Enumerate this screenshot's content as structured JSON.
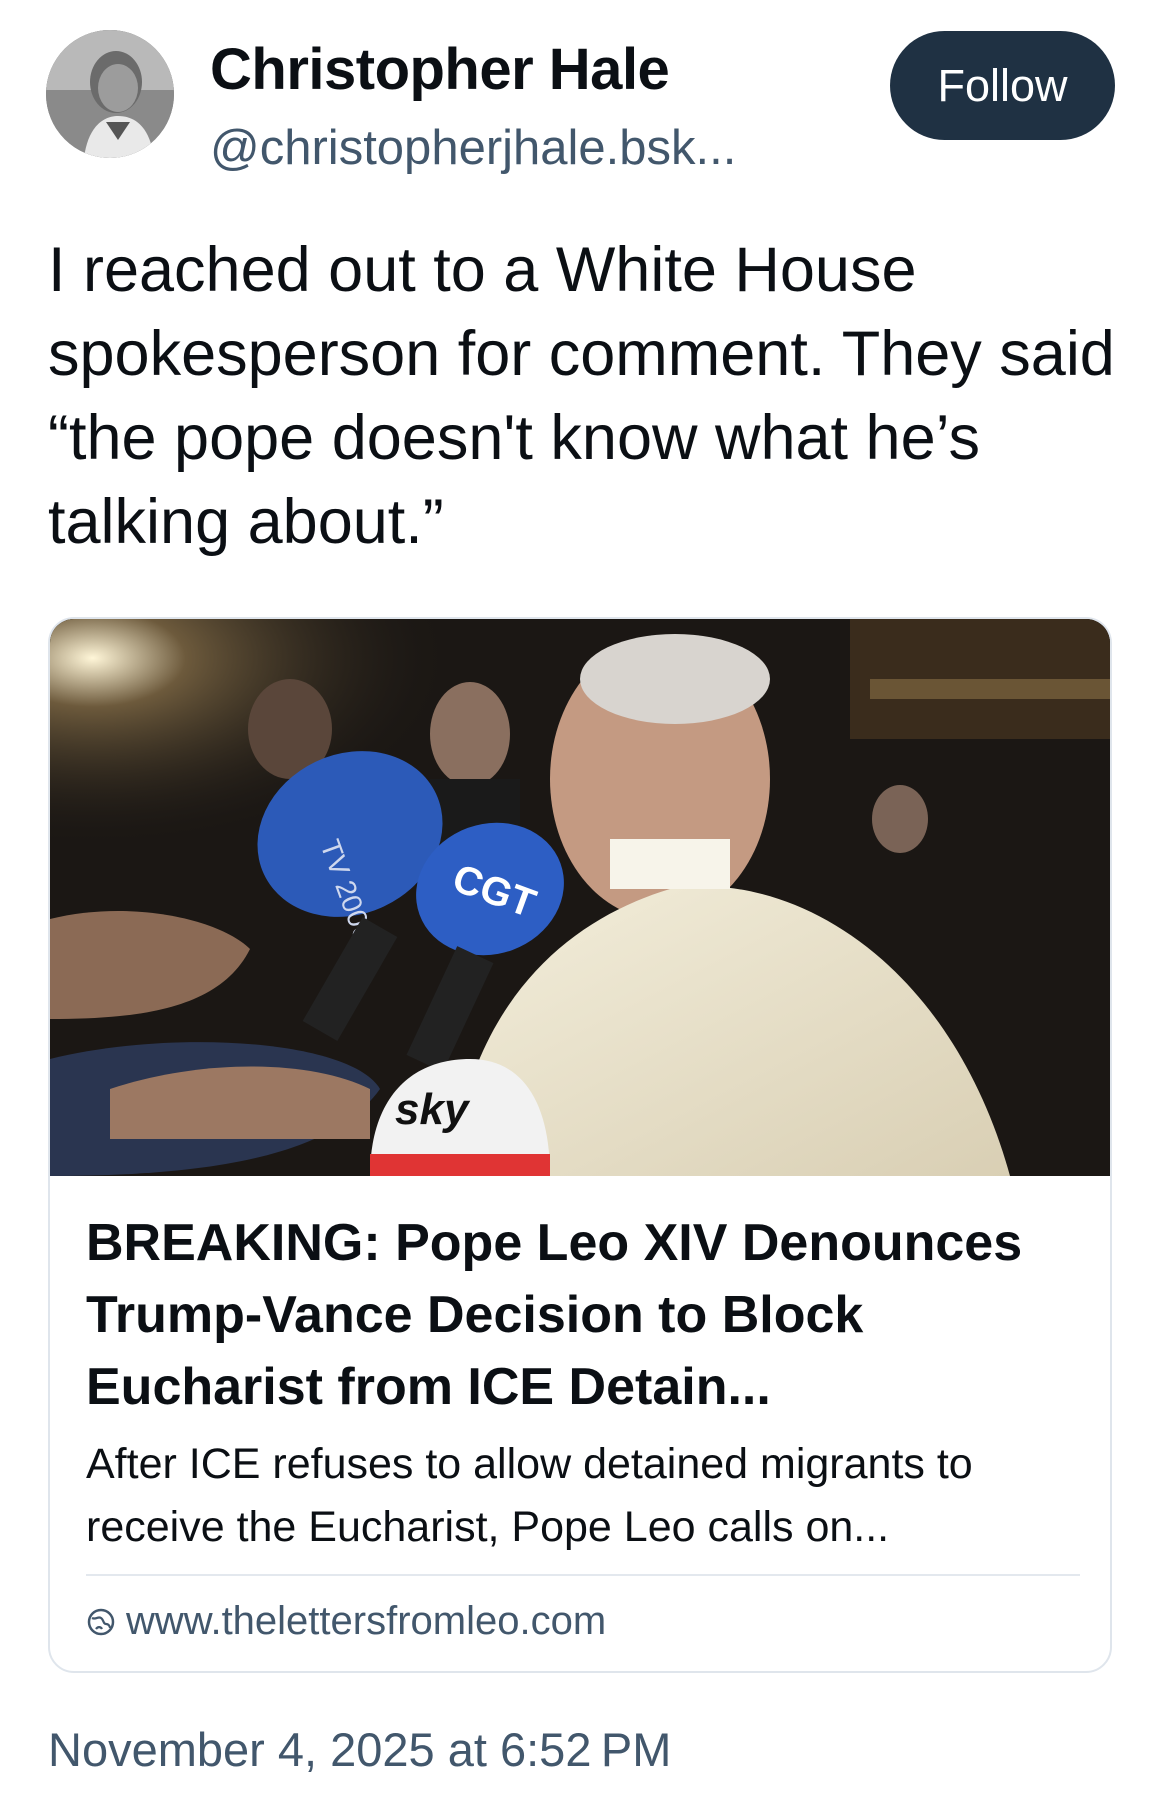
{
  "author": {
    "display_name": "Christopher Hale",
    "handle": "@christopherjhale.bsk...",
    "avatar_icon": "profile-photo"
  },
  "follow_button": {
    "label": "Follow",
    "color": "#1f3143"
  },
  "post": {
    "text": "I reached out to a White House spokesperson for comment. They said “the pope doesn't know what he’s talking about.”"
  },
  "embed": {
    "image_icon": "news-photo",
    "title": "BREAKING: Pope Leo XIV Denounces Trump-Vance Decision to Block Eucharist from ICE Detain...",
    "description": "After ICE refuses to allow detained migrants to receive the Eucharist, Pope Leo calls on...",
    "link_icon": "globe-icon",
    "url": "www.thelettersfromleo.com"
  },
  "timestamp": "November 4, 2025 at 6:52 PM",
  "colors": {
    "text_primary": "#0b0f14",
    "text_secondary": "#42576c",
    "border": "#dfe5ec"
  }
}
